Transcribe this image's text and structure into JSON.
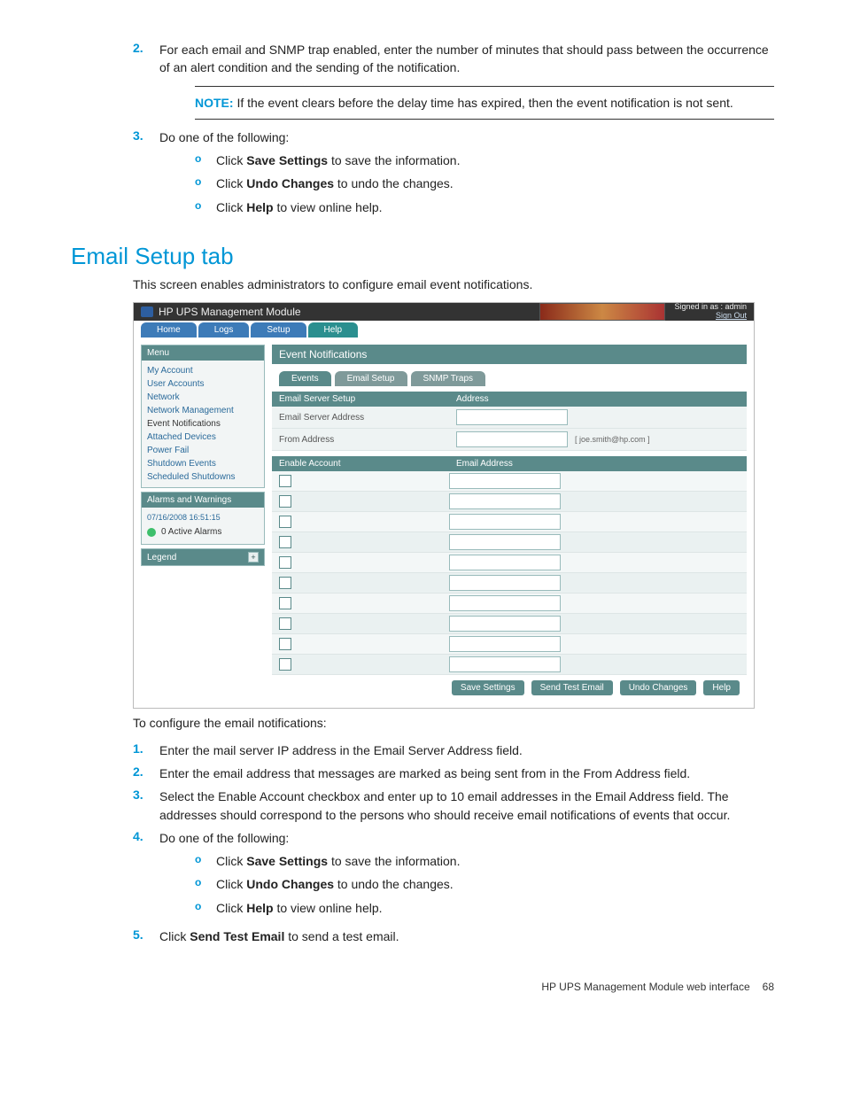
{
  "steps_top": [
    {
      "n": "2.",
      "text": "For each email and SNMP trap enabled, enter the number of minutes that should pass between the occurrence of an alert condition and the sending of the notification."
    }
  ],
  "note": {
    "label": "NOTE:",
    "text": " If the event clears before the delay time has expired, then the event notification is not sent."
  },
  "step3": {
    "n": "3.",
    "lead": "Do one of the following:",
    "subs": [
      {
        "pre": "Click ",
        "bold": "Save Settings",
        "post": " to save the information."
      },
      {
        "pre": "Click ",
        "bold": "Undo Changes",
        "post": " to undo the changes."
      },
      {
        "pre": "Click ",
        "bold": "Help",
        "post": " to view online help."
      }
    ]
  },
  "section_title": "Email Setup tab",
  "intro": "This screen enables administrators to configure email event notifications.",
  "shot": {
    "title": "HP UPS Management Module",
    "signed": "Signed in as : admin",
    "signout": "Sign Out",
    "tabs": [
      "Home",
      "Logs",
      "Setup",
      "Help"
    ],
    "menu_hd": "Menu",
    "menu": [
      "My Account",
      "User Accounts",
      "Network",
      "Network Management",
      "Event Notifications",
      "Attached Devices",
      "Power Fail",
      "Shutdown Events",
      "Scheduled Shutdowns"
    ],
    "alarms_hd": "Alarms and Warnings",
    "timestamp": "07/16/2008 16:51:15",
    "alarms": "0 Active Alarms",
    "legend": "Legend",
    "content_hd": "Event Notifications",
    "subtabs": [
      "Events",
      "Email Setup",
      "SNMP Traps"
    ],
    "srv_hd1": "Email Server Setup",
    "srv_hd2": "Address",
    "srv_addr": "Email Server Address",
    "from": "From Address",
    "from_hint": "[ joe.smith@hp.com ]",
    "acct_hd1": "Enable Account",
    "acct_hd2": "Email Address",
    "rows": 10,
    "btns": [
      "Save Settings",
      "Send Test Email",
      "Undo Changes",
      "Help"
    ]
  },
  "after_intro": "To configure the email notifications:",
  "steps_bottom": [
    {
      "n": "1.",
      "text": "Enter the mail server IP address in the Email Server Address field."
    },
    {
      "n": "2.",
      "text": "Enter the email address that messages are marked as being sent from in the From Address field."
    },
    {
      "n": "3.",
      "text": "Select the Enable Account checkbox and enter up to 10 email addresses in the Email Address field. The addresses should correspond to the persons who should receive email notifications of events that occur."
    }
  ],
  "step4b": {
    "n": "4.",
    "lead": "Do one of the following:",
    "subs": [
      {
        "pre": "Click ",
        "bold": "Save Settings",
        "post": " to save the information."
      },
      {
        "pre": "Click ",
        "bold": "Undo Changes",
        "post": " to undo the changes."
      },
      {
        "pre": "Click ",
        "bold": "Help",
        "post": " to view online help."
      }
    ]
  },
  "step5": {
    "n": "5.",
    "pre": "Click ",
    "bold": "Send Test Email",
    "post": " to send a test email."
  },
  "footer": {
    "title": "HP UPS Management Module web interface",
    "page": "68"
  }
}
